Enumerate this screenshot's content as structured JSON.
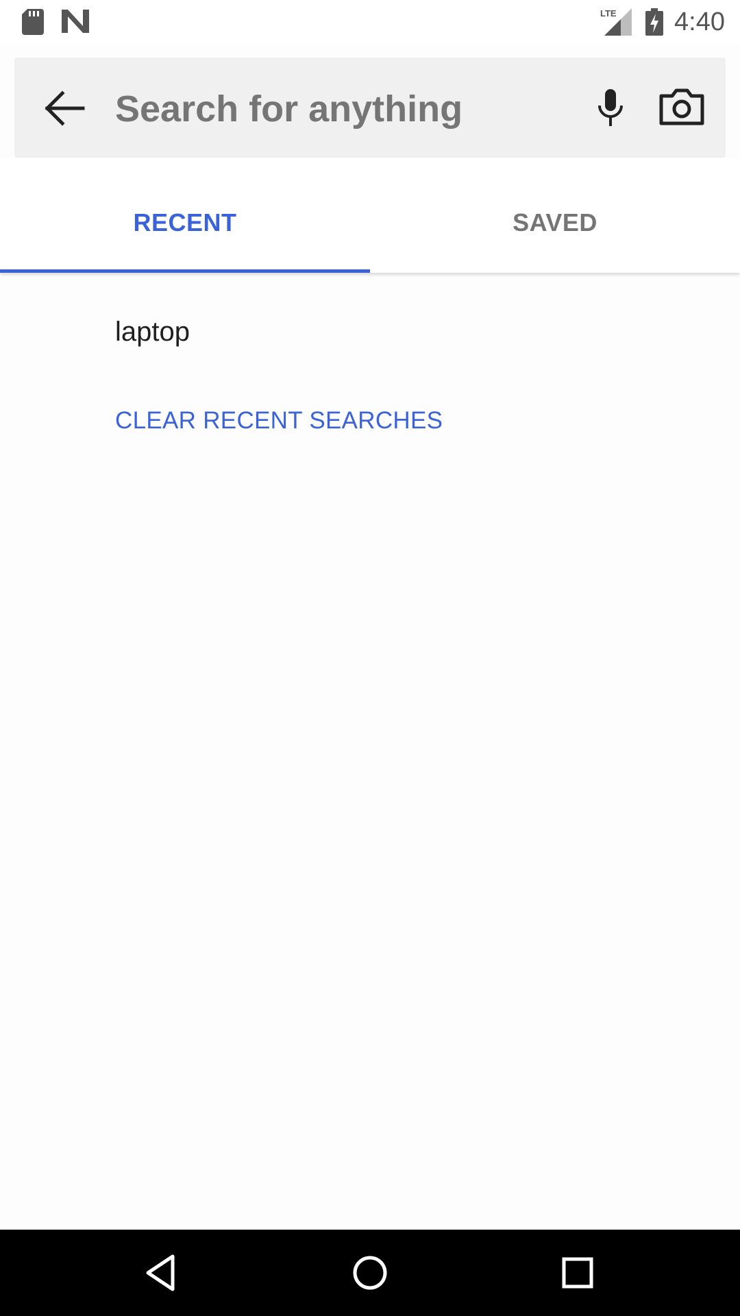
{
  "status_bar": {
    "time": "4:40",
    "network_label": "LTE",
    "icons": [
      "sd-card-icon",
      "n-logo-icon",
      "lte-signal-icon",
      "battery-charging-icon"
    ]
  },
  "search": {
    "placeholder": "Search for anything",
    "value": "",
    "icons": [
      "back-arrow-icon",
      "microphone-icon",
      "camera-icon"
    ]
  },
  "tabs": [
    {
      "label": "RECENT",
      "selected": true
    },
    {
      "label": "SAVED",
      "selected": false
    }
  ],
  "recent_searches": [
    "laptop"
  ],
  "actions": {
    "clear_recent": "CLEAR RECENT SEARCHES"
  },
  "nav_bar": {
    "icons": [
      "nav-back-icon",
      "nav-home-icon",
      "nav-recents-icon"
    ]
  },
  "colors": {
    "accent": "#3b63d9",
    "search_bar_bg": "#f0f0f0",
    "inactive_tab": "#757575",
    "nav_bar_bg": "#000000"
  }
}
